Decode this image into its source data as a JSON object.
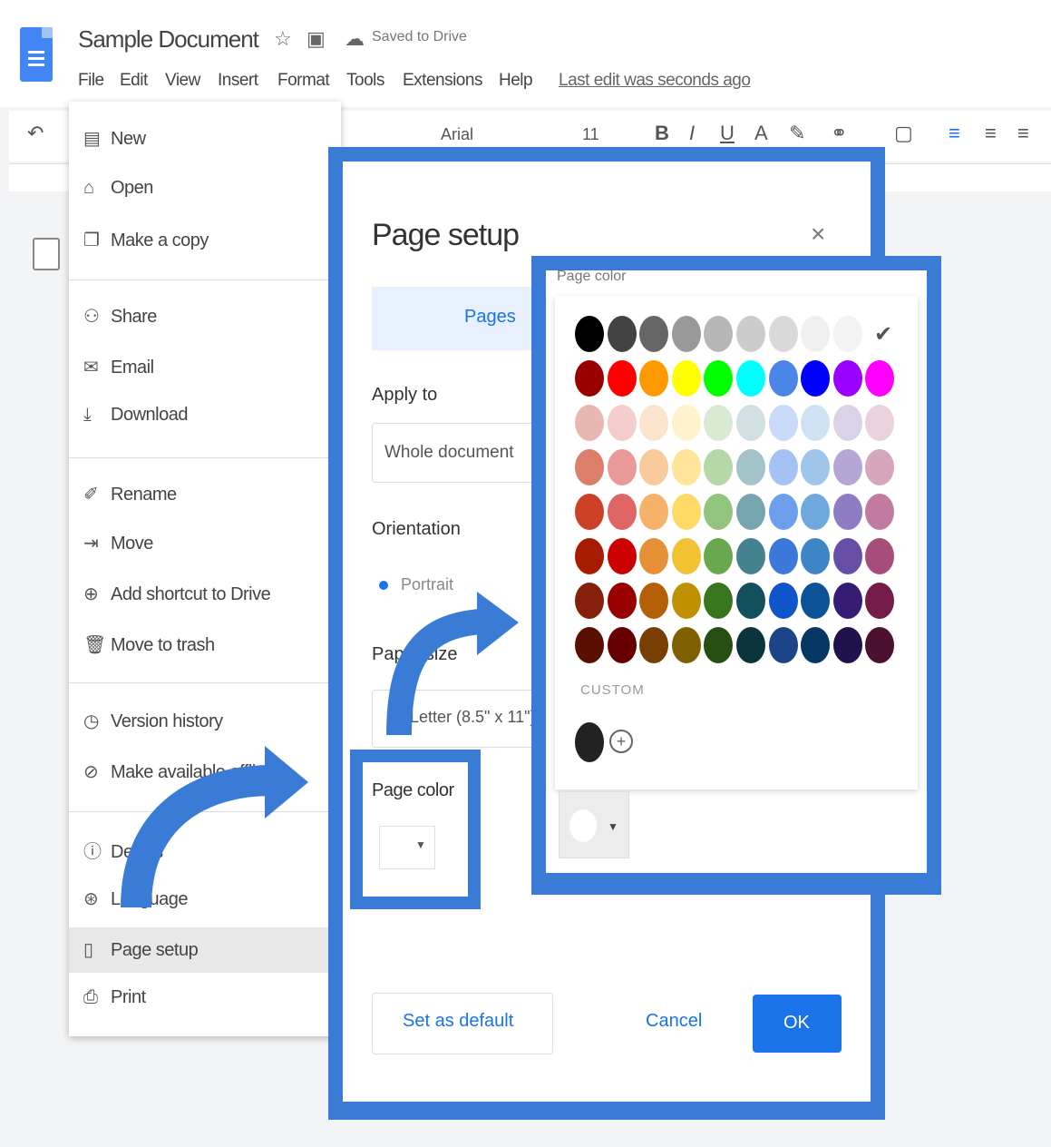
{
  "app": {
    "doc_title": "Sample Document",
    "star_icon": "star-outline-icon",
    "move_icon": "folder-icon",
    "cloud_icon": "cloud-icon",
    "saved_status": "Saved to Drive"
  },
  "menubar": {
    "items": [
      "File",
      "Edit",
      "View",
      "Insert",
      "Format",
      "Tools",
      "Extensions",
      "Help"
    ],
    "last_edit": "Last edit was seconds ago"
  },
  "toolbar": {
    "undo_icon": "undo-icon",
    "font_label": "Arial",
    "font_size": "11",
    "bold": "B",
    "italic": "I",
    "underline": "U",
    "text_color": "A"
  },
  "file_menu": {
    "items": [
      {
        "label": "New",
        "icon": "new-doc-icon"
      },
      {
        "label": "Open",
        "icon": "folder-open-icon"
      },
      {
        "label": "Make a copy",
        "icon": "copy-icon"
      },
      {
        "label": "Share",
        "icon": "share-icon"
      },
      {
        "label": "Email",
        "icon": "email-icon"
      },
      {
        "label": "Download",
        "icon": "download-icon"
      },
      {
        "label": "Rename",
        "icon": "rename-icon"
      },
      {
        "label": "Move",
        "icon": "move-icon"
      },
      {
        "label": "Add shortcut to Drive",
        "icon": "shortcut-icon"
      },
      {
        "label": "Move to trash",
        "icon": "trash-icon"
      },
      {
        "label": "Version history",
        "icon": "history-icon"
      },
      {
        "label": "Make available offline",
        "icon": "offline-icon"
      },
      {
        "label": "Details",
        "icon": "info-icon"
      },
      {
        "label": "Language",
        "icon": "globe-icon"
      },
      {
        "label": "Page setup",
        "icon": "page-icon"
      },
      {
        "label": "Print",
        "icon": "print-icon"
      }
    ]
  },
  "page_setup": {
    "title": "Page setup",
    "close": "×",
    "tab_pages": "Pages",
    "apply_label": "Apply to",
    "apply_value": "Whole document",
    "orientation_label": "Orientation",
    "orientation_value": "Portrait",
    "paper_size_label": "Paper size",
    "paper_size_value": "Letter (8.5\" x 11\")",
    "page_color_label": "Page color",
    "set_default": "Set as default",
    "cancel": "Cancel",
    "ok": "OK"
  },
  "color_picker": {
    "title": "Page color",
    "custom_label": "CUSTOM",
    "add_custom": "+",
    "selected": "#ffffff",
    "rows": [
      [
        "#000000",
        "#434343",
        "#666666",
        "#999999",
        "#b7b7b7",
        "#cccccc",
        "#d9d9d9",
        "#efefef",
        "#f3f3f3",
        "#ffffff"
      ],
      [
        "#980000",
        "#ff0000",
        "#ff9900",
        "#ffff00",
        "#00ff00",
        "#00ffff",
        "#4a86e8",
        "#0000ff",
        "#9900ff",
        "#ff00ff"
      ],
      [
        "#e6b8af",
        "#f4cccc",
        "#fce5cd",
        "#fff2cc",
        "#d9ead3",
        "#d0e0e3",
        "#c9daf8",
        "#cfe2f3",
        "#d9d2e9",
        "#ead1dc"
      ],
      [
        "#dd7e6b",
        "#ea9999",
        "#f9cb9c",
        "#ffe599",
        "#b6d7a8",
        "#a2c4c9",
        "#a4c2f4",
        "#9fc5e8",
        "#b4a7d6",
        "#d5a6bd"
      ],
      [
        "#cc4125",
        "#e06666",
        "#f6b26b",
        "#ffd966",
        "#93c47d",
        "#76a5af",
        "#6d9eeb",
        "#6fa8dc",
        "#8e7cc3",
        "#c27ba0"
      ],
      [
        "#a61c00",
        "#cc0000",
        "#e69138",
        "#f1c232",
        "#6aa84f",
        "#45818e",
        "#3c78d8",
        "#3d85c6",
        "#674ea7",
        "#a64d79"
      ],
      [
        "#85200c",
        "#990000",
        "#b45f06",
        "#bf9000",
        "#38761d",
        "#134f5c",
        "#1155cc",
        "#0b5394",
        "#351c75",
        "#741b47"
      ],
      [
        "#5b0f00",
        "#660000",
        "#783f04",
        "#7f6000",
        "#274e13",
        "#0c343d",
        "#1c4587",
        "#073763",
        "#20124d",
        "#4c1130"
      ]
    ]
  },
  "colors": {
    "highlight_frame": "#3a7bd5",
    "primary": "#1a73e8"
  }
}
